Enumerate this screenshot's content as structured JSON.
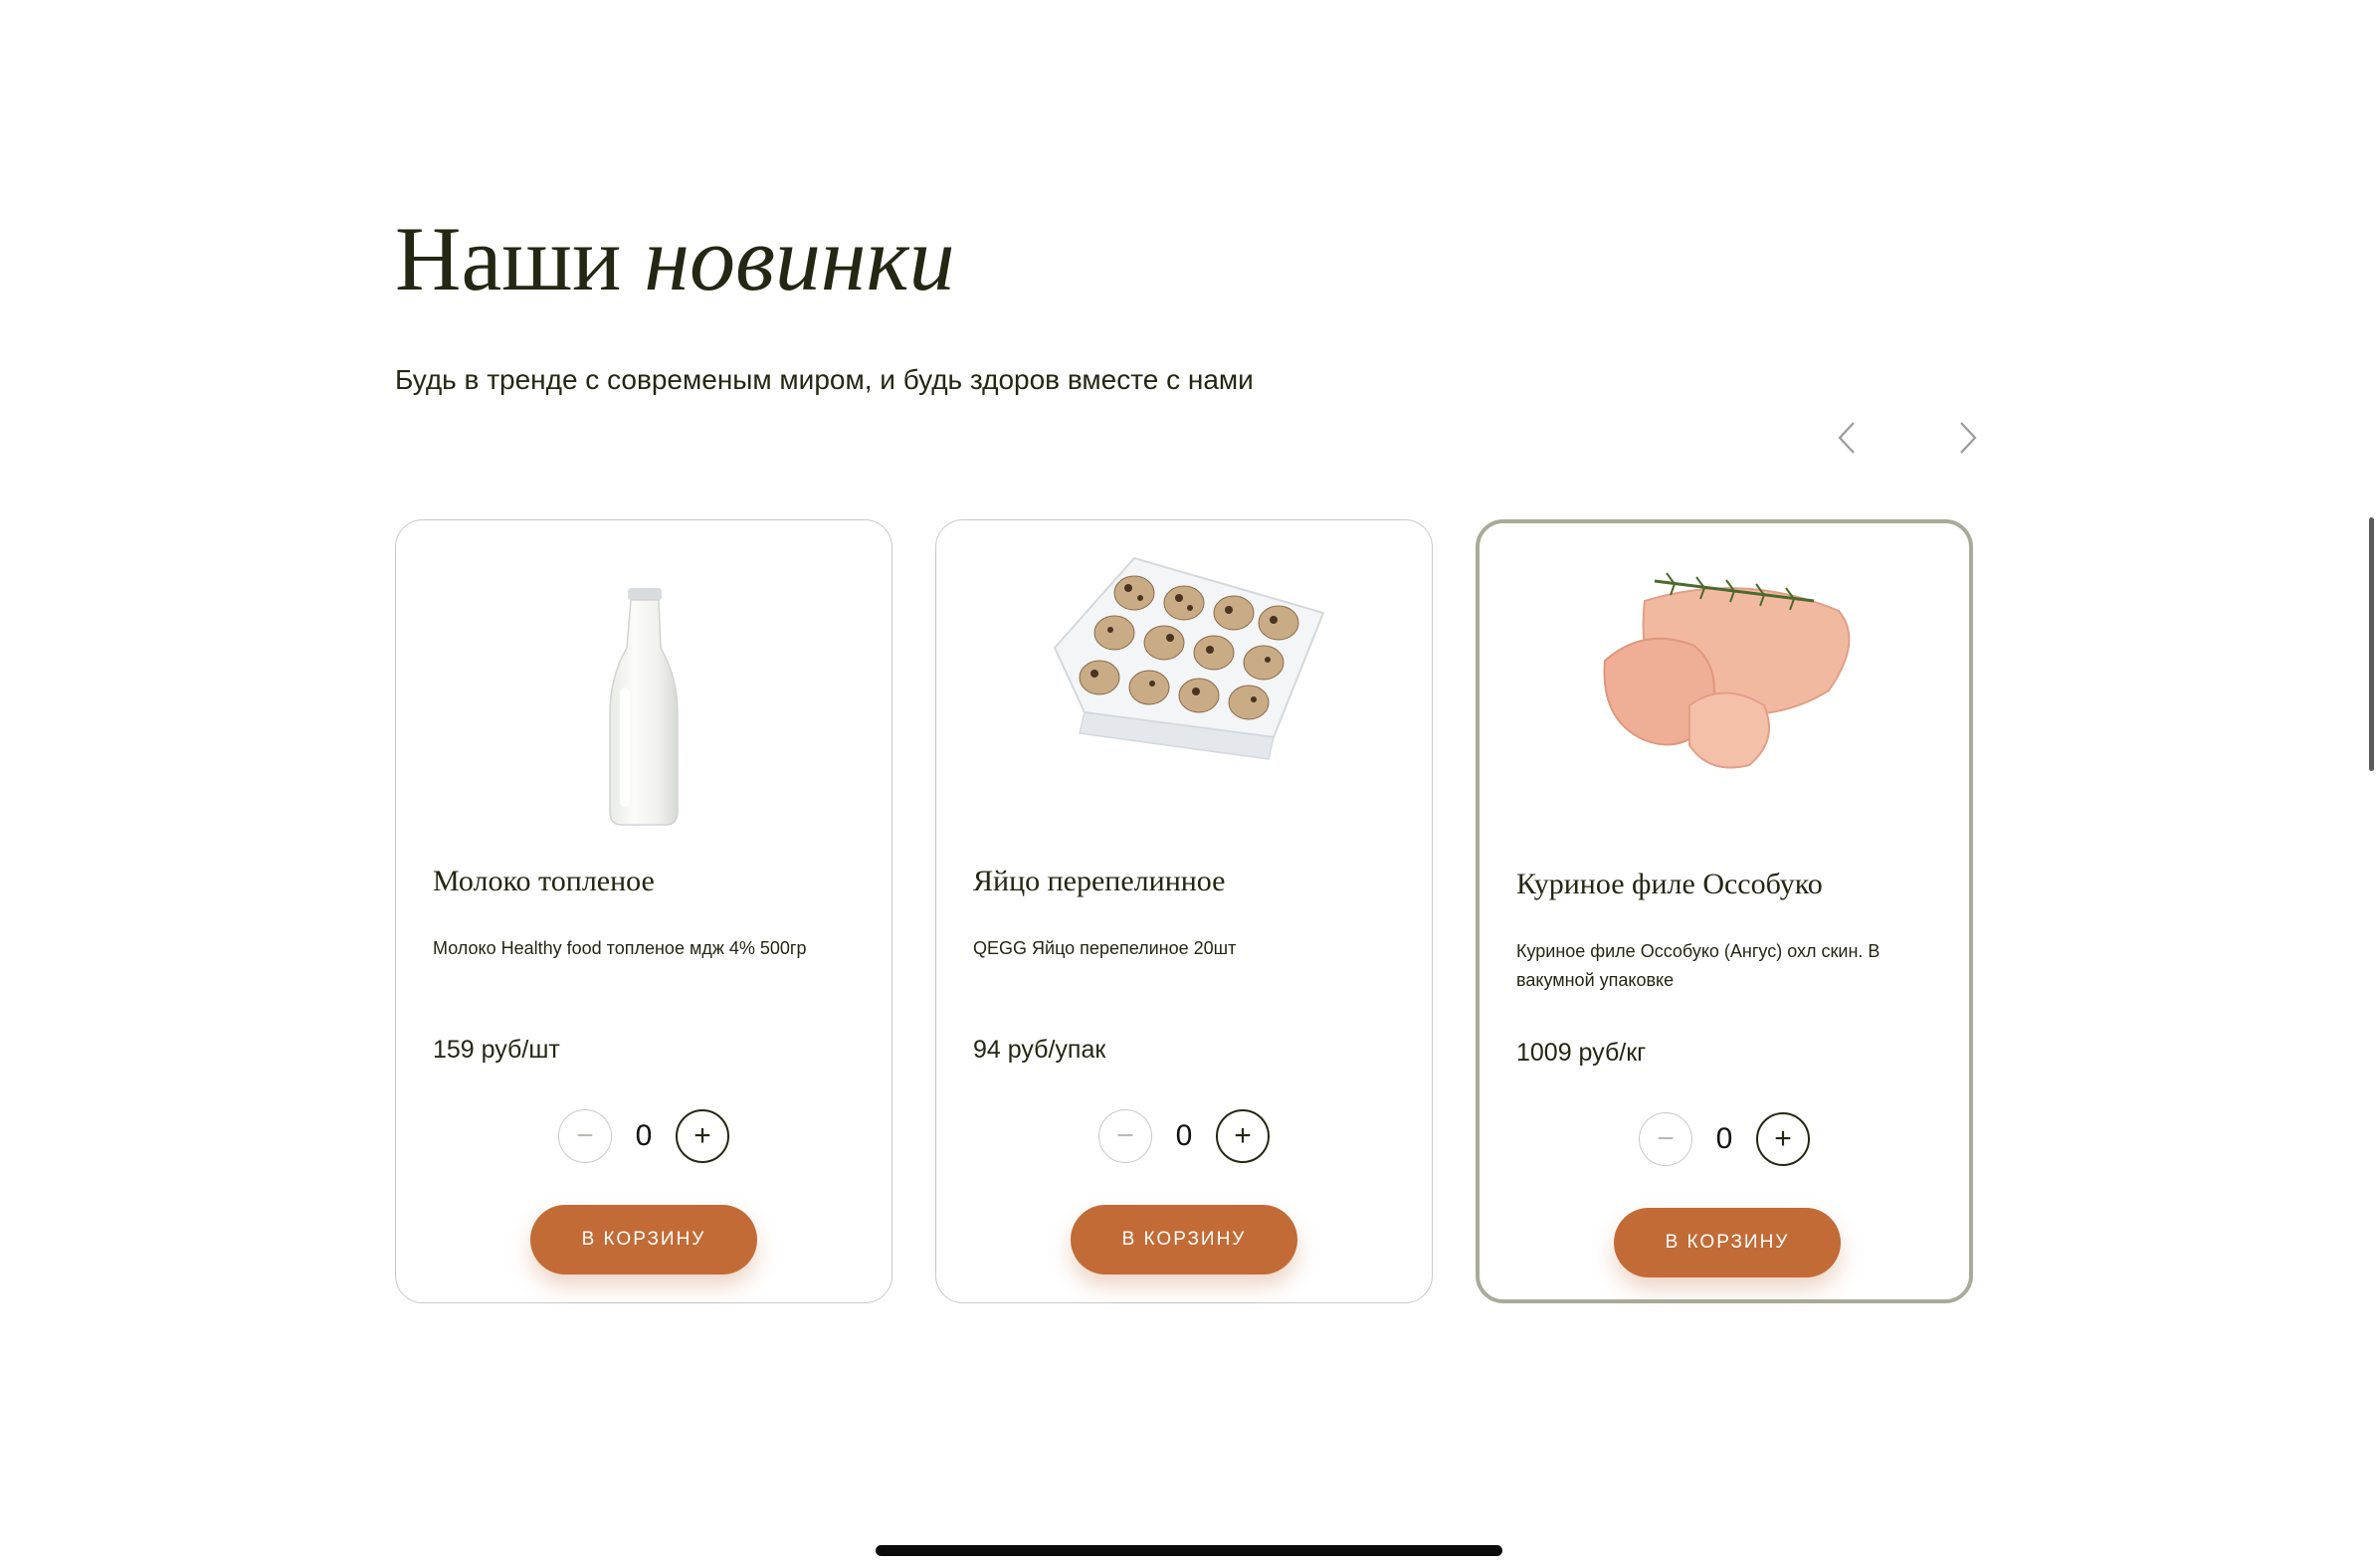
{
  "section": {
    "title_plain": "Наши",
    "title_accent": "новинки",
    "subtitle": "Будь в тренде с современым миром, и будь здоров вместе с нами"
  },
  "carousel": {
    "prev_icon": "chevron-left-icon",
    "next_icon": "chevron-right-icon"
  },
  "products": [
    {
      "title": "Молоко топленое",
      "description": "Молоко Healthy food топленое мдж 4% 500гр",
      "price": "159 руб/шт",
      "quantity": "0",
      "cart_label": "В КОРЗИНУ",
      "image": "milk-bottle"
    },
    {
      "title": "Яйцо перепелинное",
      "description": "QEGG Яйцо перепелиное 20шт",
      "price": "94 руб/упак",
      "quantity": "0",
      "cart_label": "В КОРЗИНУ",
      "image": "quail-eggs-tray"
    },
    {
      "title": "Куриное филе Оссобуко",
      "description": "Куриное филе Оссобуко (Ангус) охл скин. В вакумной упаковке",
      "price": "1009 руб/кг",
      "quantity": "0",
      "cart_label": "В КОРЗИНУ",
      "image": "chicken-fillet"
    }
  ],
  "qty_controls": {
    "minus": "−",
    "plus": "+"
  },
  "colors": {
    "text": "#232713",
    "accent": "#c36b36",
    "card_border": "#c9c9c6",
    "active_card_border": "#aaaa9c"
  }
}
